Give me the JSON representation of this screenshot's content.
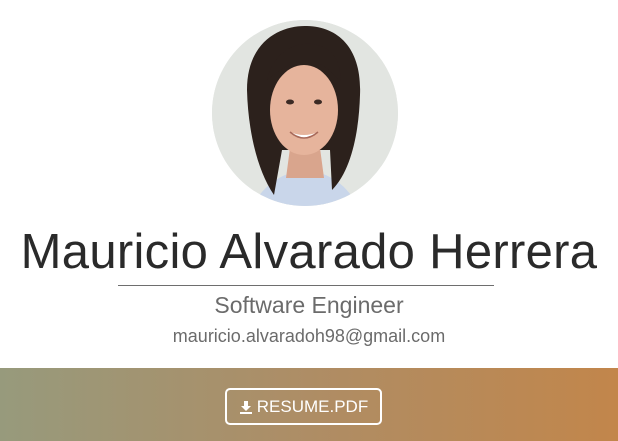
{
  "profile": {
    "name": "Mauricio Alvarado Herrera",
    "role": "Software Engineer",
    "email": "mauricio.alvaradoh98@gmail.com"
  },
  "resume": {
    "label": "RESUME.PDF",
    "icon": "download-icon"
  },
  "colors": {
    "band_start": "#979a7c",
    "band_end": "#c2864b",
    "name_text": "#2a2a2a",
    "secondary_text": "#6b6b6b"
  }
}
